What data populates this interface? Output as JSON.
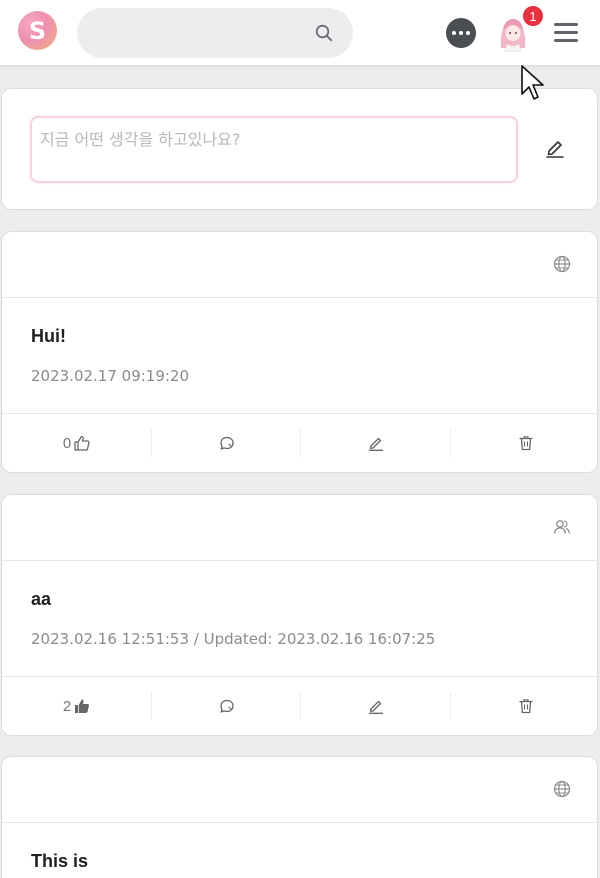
{
  "header": {
    "logo_letter": "S",
    "search": {
      "placeholder": "",
      "value": ""
    },
    "notification_count": "1"
  },
  "composer": {
    "placeholder": "지금 어떤 생각을 하고있나요?"
  },
  "posts": [
    {
      "visibility_icon": "globe-icon",
      "title": "Hui!",
      "meta": "2023.02.17 09:19:20",
      "likes": "0",
      "liked": false
    },
    {
      "visibility_icon": "friends-icon",
      "title": "aa",
      "meta": "2023.02.16 12:51:53 / Updated: 2023.02.16 16:07:25",
      "likes": "2",
      "liked": true
    },
    {
      "visibility_icon": "globe-icon",
      "title": "This is",
      "meta": ""
    }
  ],
  "colors": {
    "accent_pink": "#f7d3d9",
    "badge_red": "#e8313f",
    "background": "#ededf0"
  }
}
